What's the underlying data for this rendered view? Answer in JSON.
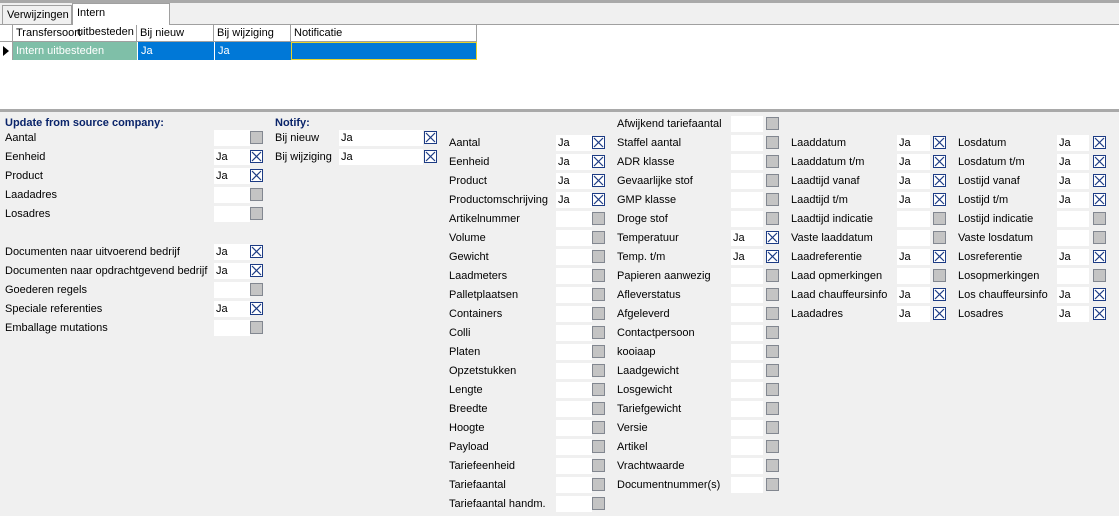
{
  "tabs": [
    {
      "label": "Verwijzingen",
      "active": false
    },
    {
      "label": "Intern uitbesteden",
      "active": true
    }
  ],
  "grid": {
    "columns": [
      "Transfersoort",
      "Bij nieuw",
      "Bij wijziging",
      "Notificatie"
    ],
    "rows": [
      {
        "transfersoort": "Intern uitbesteden",
        "bij_nieuw": "Ja",
        "bij_wijziging": "Ja",
        "notificatie": ""
      }
    ]
  },
  "update_section": {
    "title": "Update from source company:",
    "items": [
      {
        "label": "Aantal",
        "value": "",
        "checked": false
      },
      {
        "label": "Eenheid",
        "value": "Ja",
        "checked": true
      },
      {
        "label": "Product",
        "value": "Ja",
        "checked": true
      },
      {
        "label": "Laadadres",
        "value": "",
        "checked": false
      },
      {
        "label": "Losadres",
        "value": "",
        "checked": false
      },
      {
        "label": "Documenten naar uitvoerend bedrijf",
        "value": "Ja",
        "checked": true
      },
      {
        "label": "Documenten naar opdrachtgevend bedrijf",
        "value": "Ja",
        "checked": true
      },
      {
        "label": "Goederen regels",
        "value": "",
        "checked": false
      },
      {
        "label": "Speciale referenties",
        "value": "Ja",
        "checked": true
      },
      {
        "label": "Emballage mutations",
        "value": "",
        "checked": false
      }
    ]
  },
  "notify_section": {
    "title": "Notify:",
    "items": [
      {
        "label": "Bij nieuw",
        "value": "Ja",
        "checked": true
      },
      {
        "label": "Bij wijziging",
        "value": "Ja",
        "checked": true
      }
    ]
  },
  "col3": [
    {
      "label": "Aantal",
      "value": "Ja",
      "checked": true
    },
    {
      "label": "Eenheid",
      "value": "Ja",
      "checked": true
    },
    {
      "label": "Product",
      "value": "Ja",
      "checked": true
    },
    {
      "label": "Productomschrijving",
      "value": "Ja",
      "checked": true
    },
    {
      "label": "Artikelnummer",
      "value": "",
      "checked": false
    },
    {
      "label": "Volume",
      "value": "",
      "checked": false
    },
    {
      "label": "Gewicht",
      "value": "",
      "checked": false
    },
    {
      "label": "Laadmeters",
      "value": "",
      "checked": false
    },
    {
      "label": "Palletplaatsen",
      "value": "",
      "checked": false
    },
    {
      "label": "Containers",
      "value": "",
      "checked": false
    },
    {
      "label": "Colli",
      "value": "",
      "checked": false
    },
    {
      "label": "Platen",
      "value": "",
      "checked": false
    },
    {
      "label": "Opzetstukken",
      "value": "",
      "checked": false
    },
    {
      "label": "Lengte",
      "value": "",
      "checked": false
    },
    {
      "label": "Breedte",
      "value": "",
      "checked": false
    },
    {
      "label": "Hoogte",
      "value": "",
      "checked": false
    },
    {
      "label": "Payload",
      "value": "",
      "checked": false
    },
    {
      "label": "Tariefeenheid",
      "value": "",
      "checked": false
    },
    {
      "label": "Tariefaantal",
      "value": "",
      "checked": false
    },
    {
      "label": "Tariefaantal handm.",
      "value": "",
      "checked": false
    }
  ],
  "col4": [
    {
      "label": "Afwijkend tariefaantal",
      "value": "",
      "checked": false
    },
    {
      "label": "Staffel aantal",
      "value": "",
      "checked": false
    },
    {
      "label": "ADR klasse",
      "value": "",
      "checked": false
    },
    {
      "label": "Gevaarlijke stof",
      "value": "",
      "checked": false
    },
    {
      "label": "GMP klasse",
      "value": "",
      "checked": false
    },
    {
      "label": "Droge stof",
      "value": "",
      "checked": false
    },
    {
      "label": "Temperatuur",
      "value": "Ja",
      "checked": true
    },
    {
      "label": "Temp. t/m",
      "value": "Ja",
      "checked": true
    },
    {
      "label": "Papieren aanwezig",
      "value": "",
      "checked": false
    },
    {
      "label": "Afleverstatus",
      "value": "",
      "checked": false
    },
    {
      "label": "Afgeleverd",
      "value": "",
      "checked": false
    },
    {
      "label": "Contactpersoon",
      "value": "",
      "checked": false
    },
    {
      "label": "kooiaap",
      "value": "",
      "checked": false
    },
    {
      "label": "Laadgewicht",
      "value": "",
      "checked": false
    },
    {
      "label": "Losgewicht",
      "value": "",
      "checked": false
    },
    {
      "label": "Tariefgewicht",
      "value": "",
      "checked": false
    },
    {
      "label": "Versie",
      "value": "",
      "checked": false
    },
    {
      "label": "Artikel",
      "value": "",
      "checked": false
    },
    {
      "label": "Vrachtwaarde",
      "value": "",
      "checked": false
    },
    {
      "label": "Documentnummer(s)",
      "value": "",
      "checked": false
    }
  ],
  "col5": [
    {
      "label": "Laaddatum",
      "value": "Ja",
      "checked": true
    },
    {
      "label": "Laaddatum t/m",
      "value": "Ja",
      "checked": true
    },
    {
      "label": "Laadtijd vanaf",
      "value": "Ja",
      "checked": true
    },
    {
      "label": "Laadtijd t/m",
      "value": "Ja",
      "checked": true
    },
    {
      "label": "Laadtijd indicatie",
      "value": "",
      "checked": false
    },
    {
      "label": "Vaste laaddatum",
      "value": "",
      "checked": false
    },
    {
      "label": "Laadreferentie",
      "value": "Ja",
      "checked": true
    },
    {
      "label": "Laad opmerkingen",
      "value": "",
      "checked": false
    },
    {
      "label": "Laad chauffeursinfo",
      "value": "Ja",
      "checked": true
    },
    {
      "label": "Laadadres",
      "value": "Ja",
      "checked": true
    }
  ],
  "col6": [
    {
      "label": "Losdatum",
      "value": "Ja",
      "checked": true
    },
    {
      "label": "Losdatum t/m",
      "value": "Ja",
      "checked": true
    },
    {
      "label": "Lostijd vanaf",
      "value": "Ja",
      "checked": true
    },
    {
      "label": "Lostijd t/m",
      "value": "Ja",
      "checked": true
    },
    {
      "label": "Lostijd indicatie",
      "value": "",
      "checked": false
    },
    {
      "label": "Vaste losdatum",
      "value": "",
      "checked": false
    },
    {
      "label": "Losreferentie",
      "value": "Ja",
      "checked": true
    },
    {
      "label": "Losopmerkingen",
      "value": "",
      "checked": false
    },
    {
      "label": "Los chauffeursinfo",
      "value": "Ja",
      "checked": true
    },
    {
      "label": "Losadres",
      "value": "Ja",
      "checked": true
    }
  ],
  "colors": {
    "selected_row": "#0078d7",
    "first_cell": "#7fbfa8",
    "section_title": "#0a246a"
  }
}
